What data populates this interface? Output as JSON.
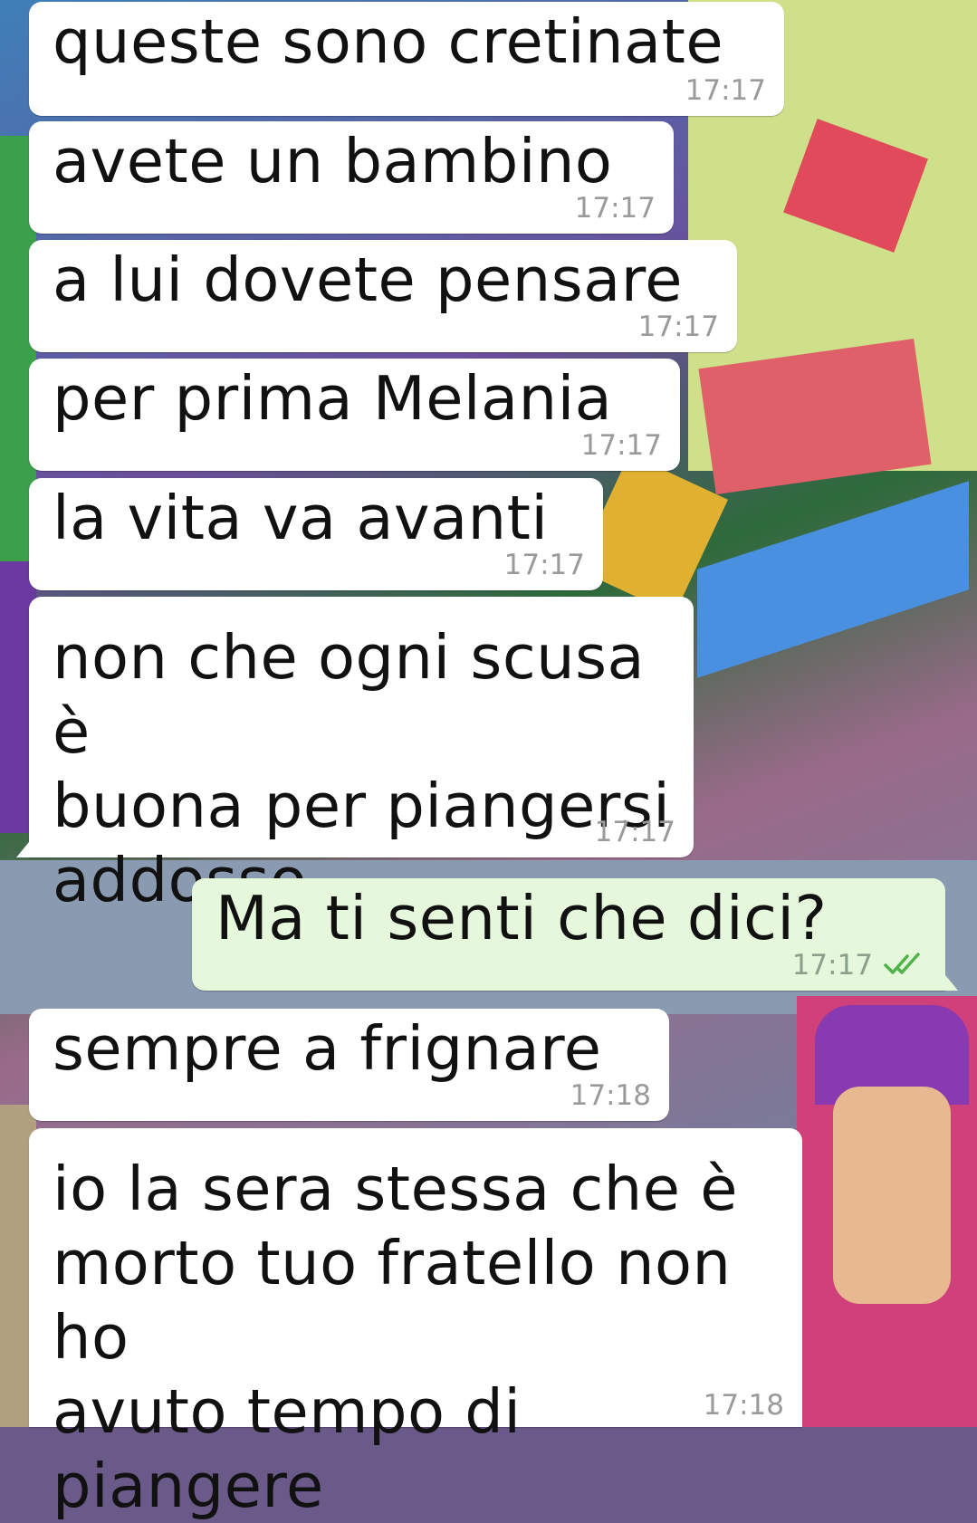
{
  "messages": [
    {
      "text": "queste sono cretinate",
      "time": "17:17",
      "direction": "incoming"
    },
    {
      "text": "avete un bambino",
      "time": "17:17",
      "direction": "incoming"
    },
    {
      "text": "a lui dovete pensare",
      "time": "17:17",
      "direction": "incoming"
    },
    {
      "text": "per prima Melania",
      "time": "17:17",
      "direction": "incoming"
    },
    {
      "text": "la vita va avanti",
      "time": "17:17",
      "direction": "incoming"
    },
    {
      "text": "non che ogni scusa è\nbuona per piangersi\naddosso",
      "time": "17:17",
      "direction": "incoming"
    },
    {
      "text": "Ma ti senti che dici?",
      "time": "17:17",
      "direction": "outgoing",
      "status": "read",
      "status_icon": "double-check-icon"
    },
    {
      "text": "sempre a frignare",
      "time": "17:18",
      "direction": "incoming"
    },
    {
      "text": "io la sera stessa che è\nmorto tuo fratello non ho\navuto tempo di piangere",
      "time": "17:18",
      "direction": "incoming"
    }
  ],
  "colors": {
    "incoming_bubble": "#ffffff",
    "outgoing_bubble": "#e6f8dc",
    "read_ticks": "#4fb34a",
    "timestamp": "#9a9a9a"
  }
}
